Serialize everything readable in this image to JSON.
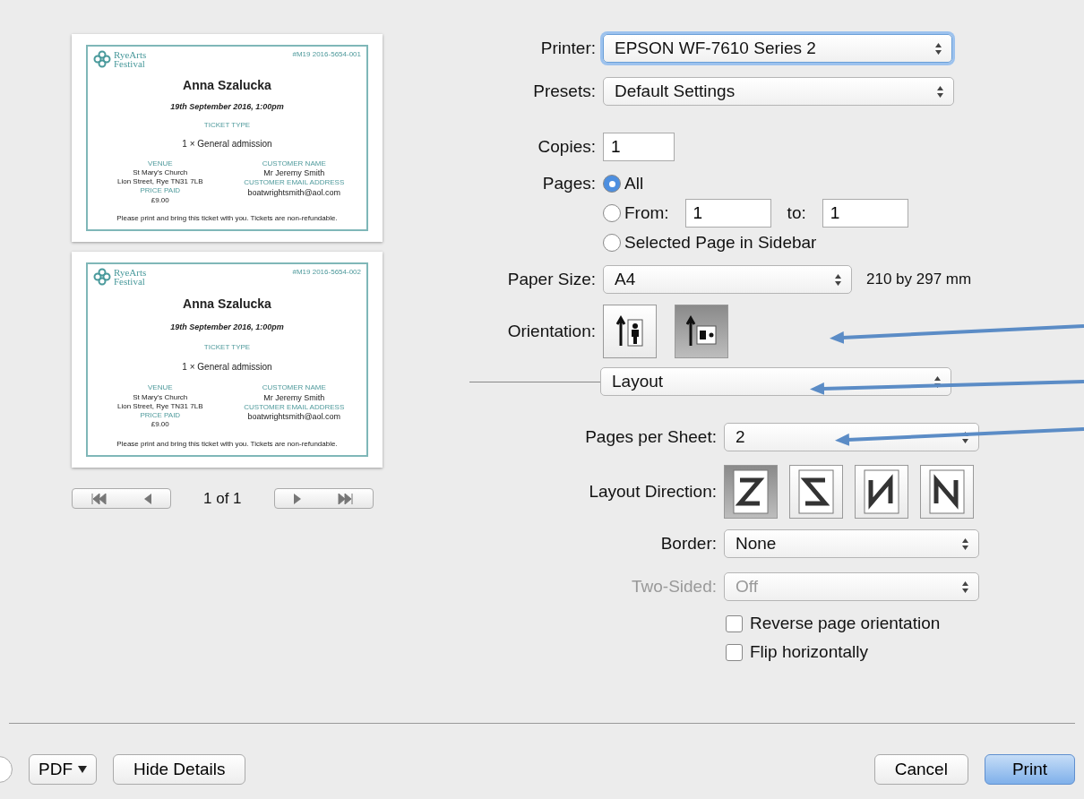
{
  "preview": {
    "pages": [
      {
        "logo_top": "RyeArts",
        "logo_bottom": "Festival",
        "ticket_id": "#M19 2016-5654-001",
        "name": "Anna Szalucka",
        "date": "19th September 2016, 1:00pm",
        "type_label": "TICKET TYPE",
        "type_value": "1 × General admission",
        "venue_label": "VENUE",
        "venue_lines": [
          "St Mary's Church",
          "Lion Street, Rye TN31 7LB"
        ],
        "price_label": "PRICE PAID",
        "price": "£9.00",
        "customer_label": "CUSTOMER NAME",
        "customer": "Mr Jeremy Smith",
        "email_label": "CUSTOMER EMAIL ADDRESS",
        "email": "boatwrightsmith@aol.com",
        "note": "Please print and bring this ticket with you. Tickets are non-refundable."
      },
      {
        "logo_top": "RyeArts",
        "logo_bottom": "Festival",
        "ticket_id": "#M19 2016-5654-002",
        "name": "Anna Szalucka",
        "date": "19th September 2016, 1:00pm",
        "type_label": "TICKET TYPE",
        "type_value": "1 × General admission",
        "venue_label": "VENUE",
        "venue_lines": [
          "St Mary's Church",
          "Lion Street, Rye TN31 7LB"
        ],
        "price_label": "PRICE PAID",
        "price": "£9.00",
        "customer_label": "CUSTOMER NAME",
        "customer": "Mr Jeremy Smith",
        "email_label": "CUSTOMER EMAIL ADDRESS",
        "email": "boatwrightsmith@aol.com",
        "note": "Please print and bring this ticket with you. Tickets are non-refundable."
      }
    ],
    "page_count": "1 of 1"
  },
  "form": {
    "printer": {
      "label": "Printer:",
      "value": "EPSON WF-7610 Series 2"
    },
    "presets": {
      "label": "Presets:",
      "value": "Default Settings"
    },
    "copies": {
      "label": "Copies:",
      "value": "1"
    },
    "pages": {
      "label": "Pages:",
      "options": [
        {
          "kind": "all",
          "label": "All",
          "selected": true
        },
        {
          "kind": "range",
          "label": "From:",
          "from": "1",
          "to_label": "to:",
          "to": "1",
          "selected": false
        },
        {
          "kind": "sidebar",
          "label": "Selected Page in Sidebar",
          "selected": false
        }
      ]
    },
    "paper_size": {
      "label": "Paper Size:",
      "value": "A4",
      "dimensions": "210 by 297 mm"
    },
    "orientation": {
      "label": "Orientation:",
      "options": [
        {
          "kind": "portrait",
          "selected": false
        },
        {
          "kind": "landscape",
          "selected": true
        }
      ]
    },
    "section": {
      "value": "Layout"
    },
    "pages_per_sheet": {
      "label": "Pages per Sheet:",
      "value": "2"
    },
    "layout_direction": {
      "label": "Layout Direction:",
      "options": [
        {
          "kind": "z",
          "selected": true
        },
        {
          "kind": "z-reverse",
          "selected": false
        },
        {
          "kind": "n-reverse",
          "selected": false
        },
        {
          "kind": "n",
          "selected": false
        }
      ]
    },
    "border": {
      "label": "Border:",
      "value": "None"
    },
    "two_sided": {
      "label": "Two-Sided:",
      "value": "Off",
      "disabled": true
    },
    "checkboxes": [
      {
        "label": "Reverse page orientation",
        "checked": false
      },
      {
        "label": "Flip horizontally",
        "checked": false
      }
    ]
  },
  "footer": {
    "pdf": "PDF",
    "hide_details": "Hide Details",
    "cancel": "Cancel",
    "print": "Print"
  }
}
